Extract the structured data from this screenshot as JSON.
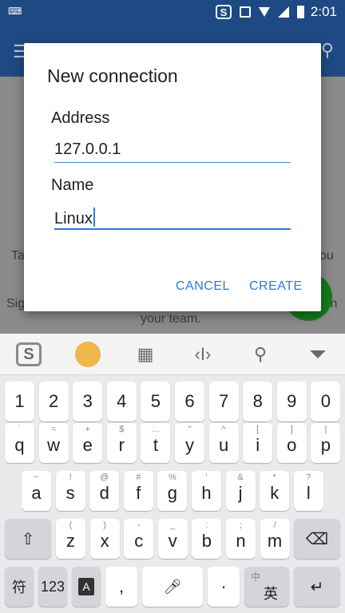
{
  "status": {
    "time": "2:01"
  },
  "background": {
    "text_left1": "Ta",
    "text_right1": "ou",
    "text_left2": "Sig",
    "text_right2": "in",
    "text_center": "your team."
  },
  "dialog": {
    "title": "New connection",
    "address_label": "Address",
    "address_value": "127.0.0.1",
    "name_label": "Name",
    "name_value": "Linux",
    "cancel": "CANCEL",
    "create": "CREATE"
  },
  "keyboard": {
    "numbers": [
      "1",
      "2",
      "3",
      "4",
      "5",
      "6",
      "7",
      "8",
      "9",
      "0"
    ],
    "row1": [
      {
        "k": "q",
        "s": "`"
      },
      {
        "k": "w",
        "s": "="
      },
      {
        "k": "e",
        "s": "+"
      },
      {
        "k": "r",
        "s": "$"
      },
      {
        "k": "t",
        "s": "..."
      },
      {
        "k": "y",
        "s": "\""
      },
      {
        "k": "u",
        "s": "^"
      },
      {
        "k": "i",
        "s": "["
      },
      {
        "k": "o",
        "s": "]"
      },
      {
        "k": "p",
        "s": "|"
      }
    ],
    "row2": [
      {
        "k": "a",
        "s": "~"
      },
      {
        "k": "s",
        "s": "!"
      },
      {
        "k": "d",
        "s": "@"
      },
      {
        "k": "f",
        "s": "#"
      },
      {
        "k": "g",
        "s": "%"
      },
      {
        "k": "h",
        "s": "'"
      },
      {
        "k": "j",
        "s": "&"
      },
      {
        "k": "k",
        "s": "*"
      },
      {
        "k": "l",
        "s": "?"
      }
    ],
    "row3": [
      {
        "k": "z",
        "s": "("
      },
      {
        "k": "x",
        "s": ")"
      },
      {
        "k": "c",
        "s": "-"
      },
      {
        "k": "v",
        "s": "_"
      },
      {
        "k": "b",
        "s": ":"
      },
      {
        "k": "n",
        "s": ";"
      },
      {
        "k": "m",
        "s": "/"
      }
    ],
    "fu": "符",
    "num": "123",
    "comma": ",",
    "period": "·",
    "lang_top": "中",
    "lang_bottom": "英"
  }
}
